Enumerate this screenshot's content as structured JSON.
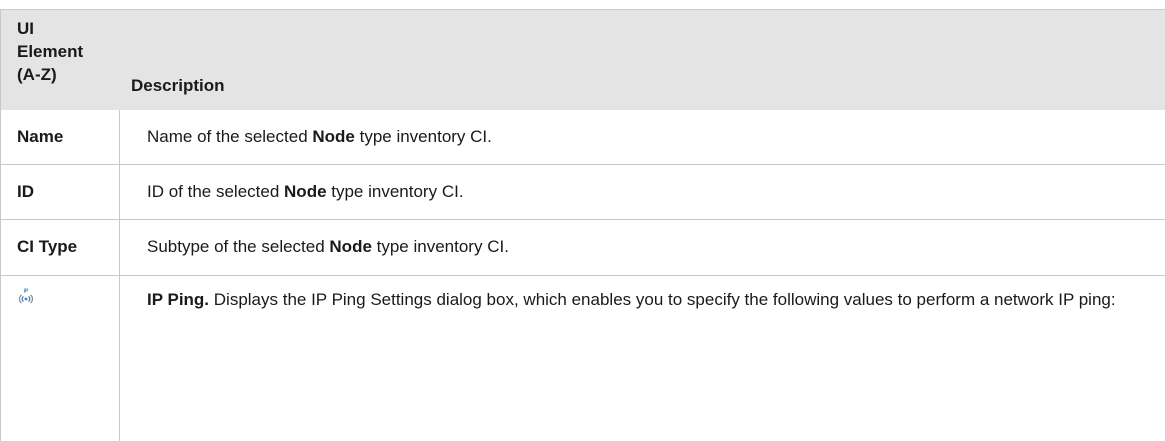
{
  "header": {
    "col1_line1": "UI",
    "col1_line2": "Element",
    "col1_line3": "(A-Z)",
    "col2": "Description"
  },
  "rows": [
    {
      "element": "Name",
      "desc_before": "Name of the selected ",
      "desc_bold": "Node",
      "desc_after": " type inventory CI."
    },
    {
      "element": "ID",
      "desc_before": "ID of the selected ",
      "desc_bold": "Node",
      "desc_after": " type inventory CI."
    },
    {
      "element": "CI Type",
      "desc_before": "Subtype of the selected ",
      "desc_bold": "Node",
      "desc_after": " type inventory CI."
    },
    {
      "element_icon": "ip-ping-icon",
      "icon_label": "IP",
      "desc_bold": "IP Ping.",
      "desc_after": " Displays the IP Ping Settings dialog box, which enables you to specify the following values to perform a network IP ping:"
    }
  ],
  "colors": {
    "header_bg": "#e4e4e4",
    "border": "#c8c8c8",
    "icon_gray": "#8a8a8a",
    "icon_blue": "#3c7fc4"
  }
}
